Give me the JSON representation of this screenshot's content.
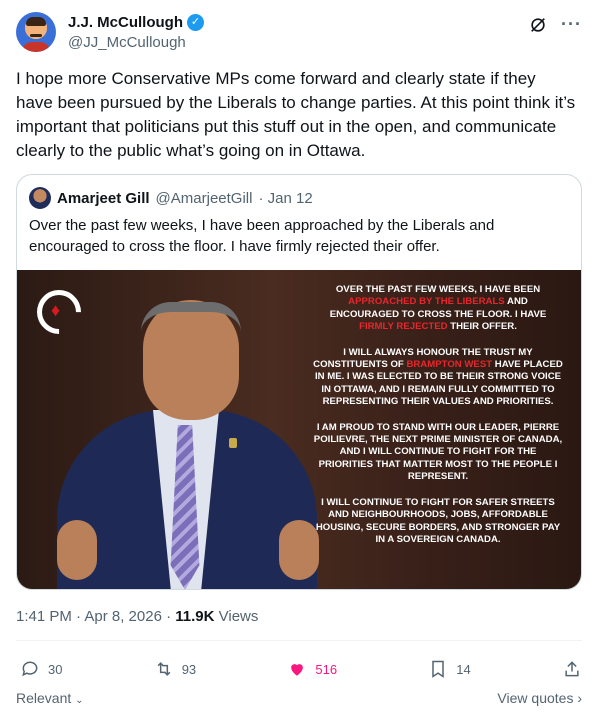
{
  "author": {
    "display_name": "J.J. McCullough",
    "handle": "@JJ_McCullough",
    "verified_mark": "✓"
  },
  "header_icons": [
    "grok-icon",
    "more-icon"
  ],
  "tweet": {
    "text": "I hope more Conservative MPs come forward and clearly state if they have been pursued by the Liberals to change parties. At this point think it’s important that politicians put this stuff out in the open, and communicate clearly to the public what’s going on in Ottawa."
  },
  "quote": {
    "name": "Amarjeet Gill",
    "handle": "@AmarjeetGill",
    "date": "· Jan 12",
    "text": "Over the past few weeks, I have been approached by the Liberals and encouraged to cross the floor. I have firmly rejected their offer.",
    "image_statement": {
      "p1_a": "Over the past few weeks, I have been ",
      "p1_red1": "approached by the Liberals",
      "p1_b": " and encouraged to cross the floor. I have ",
      "p1_red2": "firmly rejected",
      "p1_c": " their offer.",
      "p2_a": "I will always honour the trust my constituents of ",
      "p2_red": "Brampton West",
      "p2_b": " have placed in me. I was elected to be their strong voice in Ottawa, and I remain fully committed to representing their values and priorities.",
      "p3": "I am proud to stand with our leader, Pierre Poilievre, the next Prime Minister of Canada, and I will continue to fight for the priorities that matter most to the people I represent.",
      "p4": "I will continue to fight for safer streets and neighbourhoods, jobs, affordable housing, secure borders, and stronger pay in a sovereign Canada."
    }
  },
  "meta": {
    "time": "1:41 PM · Apr 8, 2026 · ",
    "views_count": "11.9K",
    "views_label": " Views"
  },
  "actions": {
    "replies": "30",
    "reposts": "93",
    "likes": "516",
    "bookmarks": "14"
  },
  "colors": {
    "like": "#f91880",
    "verified": "#1d9bf0",
    "statement_red": "#e8262c"
  },
  "footer": {
    "relevant": "Relevant",
    "view_quotes": "View quotes"
  }
}
